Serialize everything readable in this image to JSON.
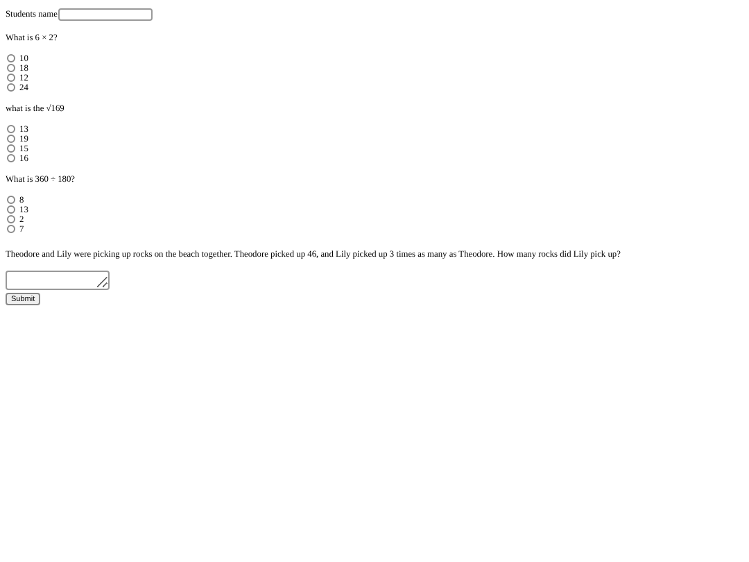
{
  "name_field": {
    "label": "Students name"
  },
  "questions": [
    {
      "text": "What is 6 × 2?",
      "options": [
        {
          "label": "10",
          "selected": false
        },
        {
          "label": "18",
          "selected": false
        },
        {
          "label": "12",
          "selected": false
        },
        {
          "label": "24",
          "selected": false
        }
      ]
    },
    {
      "text": "what is the √169",
      "options": [
        {
          "label": "13",
          "selected": false
        },
        {
          "label": "19",
          "selected": false
        },
        {
          "label": "15",
          "selected": false
        },
        {
          "label": "16",
          "selected": false
        }
      ]
    },
    {
      "text": "What is 360 ÷ 180?",
      "options": [
        {
          "label": "8",
          "selected": false
        },
        {
          "label": "13",
          "selected": false
        },
        {
          "label": "2",
          "selected": false
        },
        {
          "label": "7",
          "selected": false
        }
      ]
    }
  ],
  "word_problem": {
    "text": "Theodore and Lily were picking up rocks on the beach together. Theodore picked up 46, and Lily picked up 3 times as many as Theodore. How many rocks did Lily pick up?"
  },
  "submit_button": "Submit"
}
